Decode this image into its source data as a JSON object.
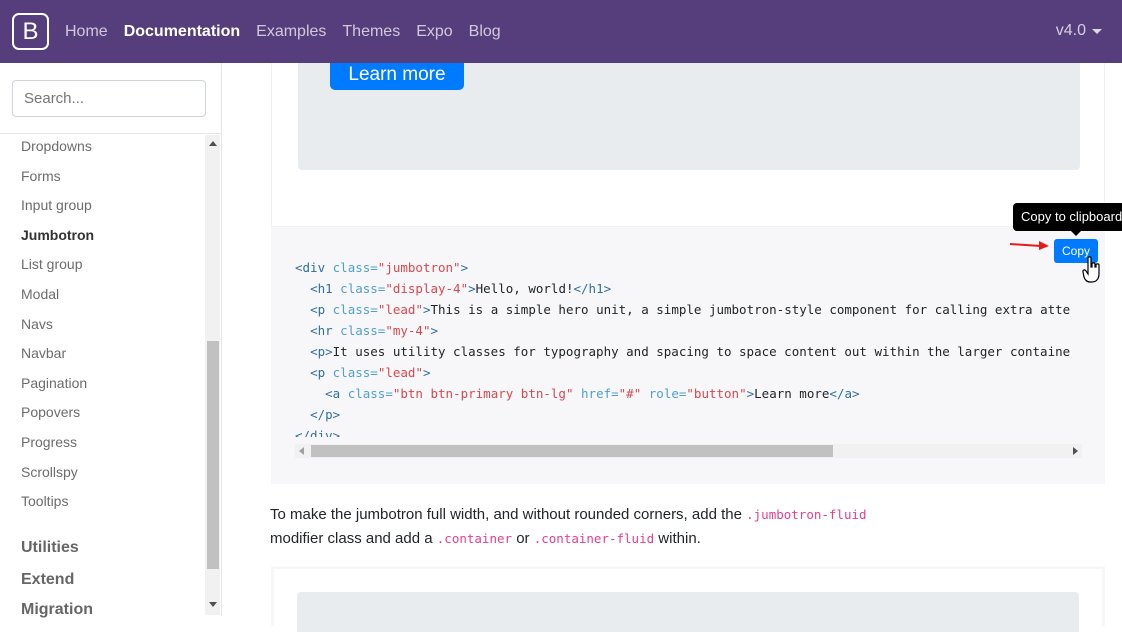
{
  "navbar": {
    "brand": "B",
    "links": [
      "Home",
      "Documentation",
      "Examples",
      "Themes",
      "Expo",
      "Blog"
    ],
    "active": "Documentation",
    "version": "v4.0"
  },
  "sidebar": {
    "search_placeholder": "Search...",
    "items": [
      "Dropdowns",
      "Forms",
      "Input group",
      "Jumbotron",
      "List group",
      "Modal",
      "Navs",
      "Navbar",
      "Pagination",
      "Popovers",
      "Progress",
      "Scrollspy",
      "Tooltips"
    ],
    "active_item": "Jumbotron",
    "sections": [
      "Utilities",
      "Extend",
      "Migration"
    ]
  },
  "example": {
    "button_label": "Learn more"
  },
  "code_block": {
    "copy_label": "Copy",
    "tooltip": "Copy to clipboard"
  },
  "paragraph": {
    "text1": "To make the jumbotron full width, and without rounded corners, add the ",
    "code1": ".jumbotron-fluid",
    "text2": "modifier class and add a ",
    "code2": ".container",
    "text3": " or ",
    "code3": ".container-fluid",
    "text4": " within."
  },
  "colors": {
    "navbar": "#563d7c",
    "primary": "#007bff",
    "jumbotron_bg": "#e9ecef",
    "code_bg": "#f7f7f9",
    "inline_code": "#e83e8c"
  }
}
